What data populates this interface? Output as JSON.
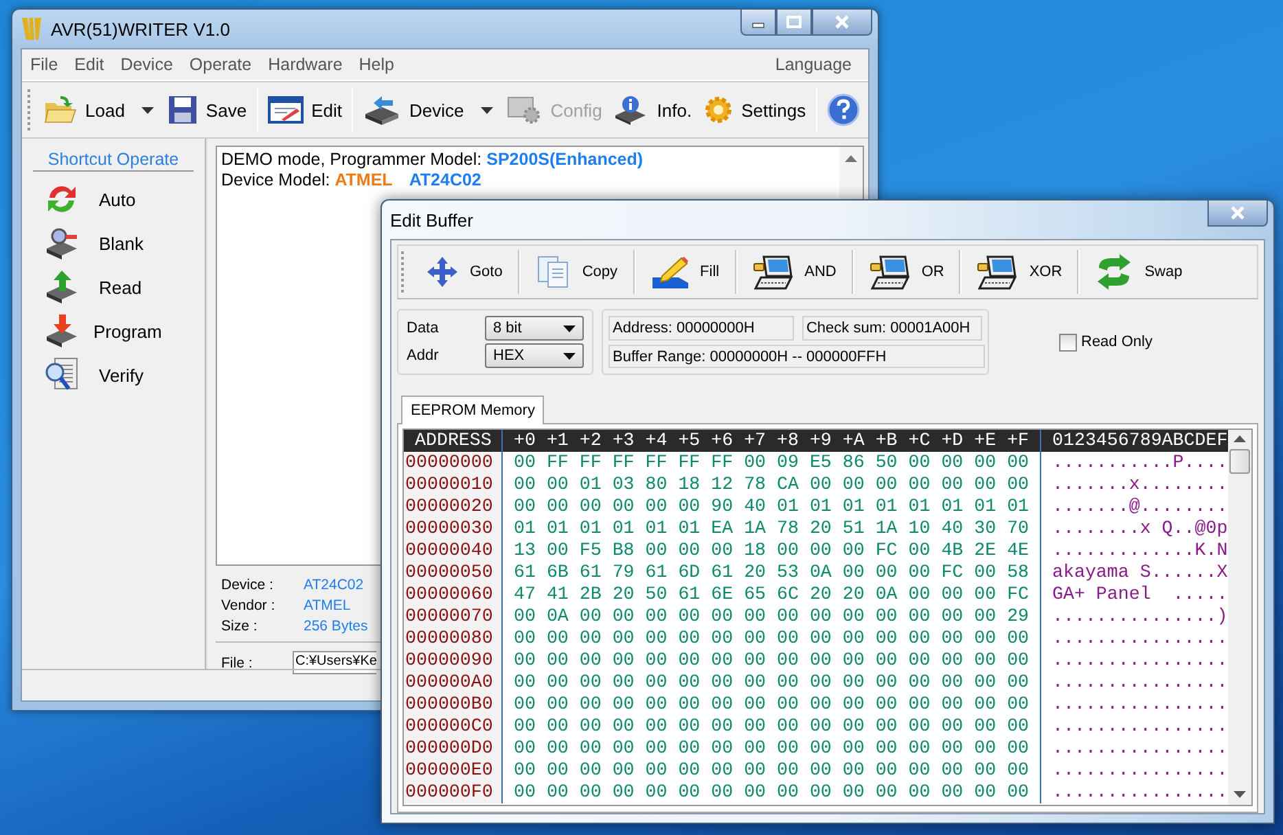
{
  "main_window": {
    "title": "AVR(51)WRITER V1.0",
    "menu": [
      "File",
      "Edit",
      "Device",
      "Operate",
      "Hardware",
      "Help"
    ],
    "menu_right": "Language",
    "toolbar": [
      {
        "label": "Load",
        "kind": "load",
        "dropdown": true,
        "disabled": false
      },
      {
        "label": "Save",
        "kind": "save",
        "dropdown": false,
        "disabled": false
      },
      {
        "label": "Edit",
        "kind": "edit",
        "dropdown": false,
        "disabled": false
      },
      {
        "label": "Device",
        "kind": "device",
        "dropdown": true,
        "disabled": false
      },
      {
        "label": "Config",
        "kind": "config",
        "dropdown": false,
        "disabled": true
      },
      {
        "label": "Info.",
        "kind": "info",
        "dropdown": false,
        "disabled": false
      },
      {
        "label": "Settings",
        "kind": "settings",
        "dropdown": false,
        "disabled": false
      },
      {
        "kind": "help",
        "dropdown": false,
        "disabled": false
      }
    ],
    "sidebar": {
      "title": "Shortcut Operate",
      "items": [
        {
          "label": "Auto",
          "kind": "auto"
        },
        {
          "label": "Blank",
          "kind": "blank"
        },
        {
          "label": "Read",
          "kind": "read"
        },
        {
          "label": "Program",
          "kind": "program"
        },
        {
          "label": "Verify",
          "kind": "verify"
        }
      ]
    },
    "log": [
      [
        {
          "text": "DEMO mode, Programmer Model: "
        },
        {
          "text": "SP200S(Enhanced)",
          "color": "#1e7ef0"
        }
      ],
      [
        {
          "text": "Device Model: "
        },
        {
          "text": "ATMEL",
          "color": "#f07a14"
        },
        {
          "text": "AT24C02",
          "color": "#1e7ef0"
        }
      ]
    ],
    "info": [
      {
        "label": "Device :",
        "value": "AT24C02"
      },
      {
        "label": "Vendor :",
        "value": "ATMEL"
      },
      {
        "label": "Size :",
        "value": "256 Bytes"
      }
    ],
    "file": {
      "label": "File :",
      "value": "C:¥Users¥Ke"
    }
  },
  "edit_buffer": {
    "title": "Edit Buffer",
    "toolbar": [
      {
        "label": "Goto",
        "kind": "goto"
      },
      {
        "label": "Copy",
        "kind": "copy"
      },
      {
        "label": "Fill",
        "kind": "fill"
      },
      {
        "label": "AND",
        "kind": "logic"
      },
      {
        "label": "OR",
        "kind": "logic"
      },
      {
        "label": "XOR",
        "kind": "logic"
      },
      {
        "label": "Swap",
        "kind": "swap"
      }
    ],
    "data": {
      "label": "Data",
      "value": "8 bit"
    },
    "addr": {
      "label": "Addr",
      "value": "HEX"
    },
    "address": "Address: 00000000H",
    "checksum": "Check sum: 00001A00H",
    "range": "Buffer Range: 00000000H -- 000000FFH",
    "read_only": {
      "label": "Read Only",
      "checked": false
    },
    "tabs": [
      {
        "label": "EEPROM Memory",
        "selected": true
      }
    ],
    "header": {
      "address": "ADDRESS",
      "columns": "+0 +1 +2 +3 +4 +5 +6 +7 +8 +9 +A +B +C +D +E +F",
      "ascii": "0123456789ABCDEF"
    },
    "rows": [
      {
        "address": "00000000",
        "hex": "00 FF FF FF FF FF FF 00 09 E5 86 50 00 00 00 00",
        "ascii": "...........P...."
      },
      {
        "address": "00000010",
        "hex": "00 00 01 03 80 18 12 78 CA 00 00 00 00 00 00 00",
        "ascii": ".......x........"
      },
      {
        "address": "00000020",
        "hex": "00 00 00 00 00 00 90 40 01 01 01 01 01 01 01 01",
        "ascii": ".......@........"
      },
      {
        "address": "00000030",
        "hex": "01 01 01 01 01 01 EA 1A 78 20 51 1A 10 40 30 70",
        "ascii": "........x Q..@0p"
      },
      {
        "address": "00000040",
        "hex": "13 00 F5 B8 00 00 00 18 00 00 00 FC 00 4B 2E 4E",
        "ascii": ".............K.N"
      },
      {
        "address": "00000050",
        "hex": "61 6B 61 79 61 6D 61 20 53 0A 00 00 00 FC 00 58",
        "ascii": "akayama S......X"
      },
      {
        "address": "00000060",
        "hex": "47 41 2B 20 50 61 6E 65 6C 20 20 0A 00 00 00 FC",
        "ascii": "GA+ Panel  ....."
      },
      {
        "address": "00000070",
        "hex": "00 0A 00 00 00 00 00 00 00 00 00 00 00 00 00 29",
        "ascii": "...............)"
      },
      {
        "address": "00000080",
        "hex": "00 00 00 00 00 00 00 00 00 00 00 00 00 00 00 00",
        "ascii": "................"
      },
      {
        "address": "00000090",
        "hex": "00 00 00 00 00 00 00 00 00 00 00 00 00 00 00 00",
        "ascii": "................"
      },
      {
        "address": "000000A0",
        "hex": "00 00 00 00 00 00 00 00 00 00 00 00 00 00 00 00",
        "ascii": "................"
      },
      {
        "address": "000000B0",
        "hex": "00 00 00 00 00 00 00 00 00 00 00 00 00 00 00 00",
        "ascii": "................"
      },
      {
        "address": "000000C0",
        "hex": "00 00 00 00 00 00 00 00 00 00 00 00 00 00 00 00",
        "ascii": "................"
      },
      {
        "address": "000000D0",
        "hex": "00 00 00 00 00 00 00 00 00 00 00 00 00 00 00 00",
        "ascii": "................"
      },
      {
        "address": "000000E0",
        "hex": "00 00 00 00 00 00 00 00 00 00 00 00 00 00 00 00",
        "ascii": "................"
      },
      {
        "address": "000000F0",
        "hex": "00 00 00 00 00 00 00 00 00 00 00 00 00 00 00 00",
        "ascii": "................"
      }
    ]
  }
}
